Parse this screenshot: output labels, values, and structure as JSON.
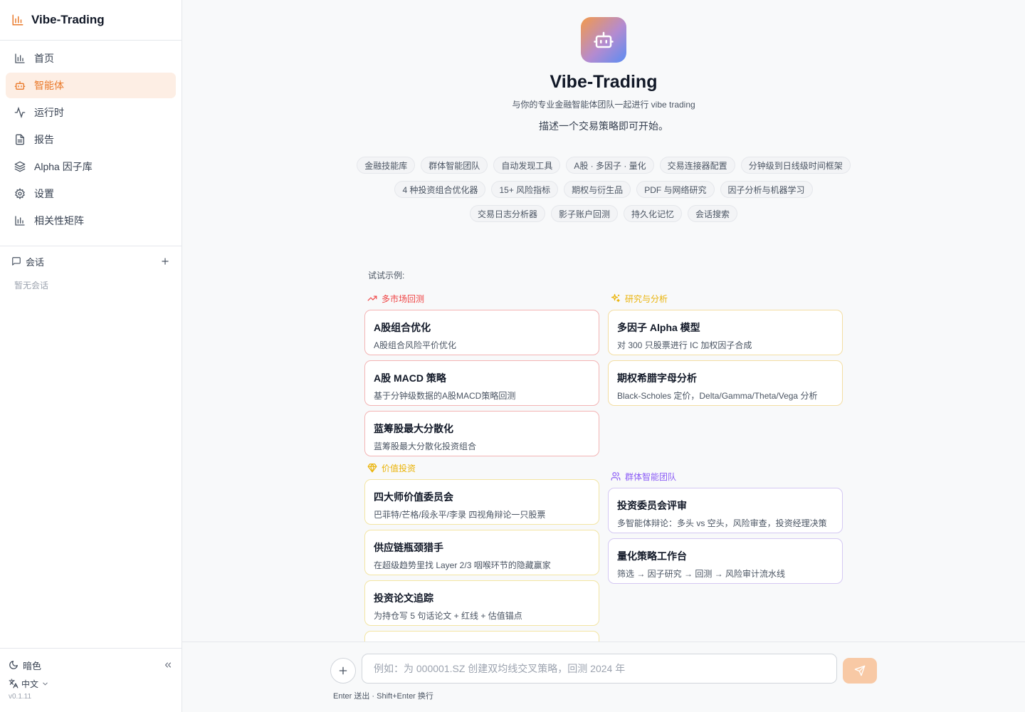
{
  "sidebar": {
    "brand": "Vibe-Trading",
    "nav": [
      {
        "label": "首页",
        "icon": "bar-chart-icon"
      },
      {
        "label": "智能体",
        "icon": "bot-icon",
        "active": true
      },
      {
        "label": "运行时",
        "icon": "activity-icon"
      },
      {
        "label": "报告",
        "icon": "file-icon"
      },
      {
        "label": "Alpha 因子库",
        "icon": "layers-icon"
      },
      {
        "label": "设置",
        "icon": "gear-icon"
      },
      {
        "label": "相关性矩阵",
        "icon": "bar-chart-icon"
      }
    ],
    "sessions_title": "会话",
    "sessions_empty": "暂无会话",
    "theme_label": "暗色",
    "language": "中文",
    "version": "v0.1.11"
  },
  "hero": {
    "title": "Vibe-Trading",
    "subtitle": "与你的专业金融智能体团队一起进行 vibe trading",
    "description": "描述一个交易策略即可开始。"
  },
  "tags": [
    "金融技能库",
    "群体智能团队",
    "自动发现工具",
    "A股 · 多因子 · 量化",
    "交易连接器配置",
    "分钟级到日线级时间框架",
    "4 种投资组合优化器",
    "15+ 风险指标",
    "期权与衍生品",
    "PDF 与网络研究",
    "因子分析与机器学习",
    "交易日志分析器",
    "影子账户回测",
    "持久化记忆",
    "会话搜索"
  ],
  "examples": {
    "label": "试试示例:",
    "categories": [
      {
        "name": "多市场回测",
        "color": "#ef4444",
        "border": "#f3b4b4",
        "icon": "trending-up-icon",
        "cards": [
          {
            "title": "A股组合优化",
            "desc": "A股组合风险平价优化"
          },
          {
            "title": "A股 MACD 策略",
            "desc": "基于分钟级数据的A股MACD策略回测"
          },
          {
            "title": "蓝筹股最大分散化",
            "desc": "蓝筹股最大分散化投资组合"
          }
        ]
      },
      {
        "name": "研究与分析",
        "color": "#eab308",
        "border": "#f3dea3",
        "icon": "sparkles-icon",
        "cards": [
          {
            "title": "多因子 Alpha 模型",
            "desc": "对 300 只股票进行 IC 加权因子合成"
          },
          {
            "title": "期权希腊字母分析",
            "desc": "Black-Scholes 定价，Delta/Gamma/Theta/Vega 分析"
          }
        ]
      },
      {
        "name": "价值投资",
        "color": "#eab308",
        "border": "#f3e5a3",
        "icon": "gem-icon",
        "cards": [
          {
            "title": "四大师价值委员会",
            "desc": "巴菲特/芒格/段永平/李录 四视角辩论一只股票"
          },
          {
            "title": "供应链瓶颈猎手",
            "desc": "在超级趋势里找 Layer 2/3 咽喉环节的隐藏赢家"
          },
          {
            "title": "投资论文追踪",
            "desc": "为持仓写 5 句话论文 + 红线 + 估值锚点"
          },
          {
            "title": "",
            "desc": ""
          }
        ]
      },
      {
        "name": "群体智能团队",
        "color": "#8b5cf6",
        "border": "#d4c8f2",
        "icon": "users-icon",
        "cards": [
          {
            "title": "投资委员会评审",
            "desc": "多智能体辩论：多头 vs 空头，风险审查，投资经理决策"
          },
          {
            "title": "量化策略工作台",
            "desc": "筛选 → 因子研究 → 回测 → 风险审计流水线"
          }
        ]
      }
    ]
  },
  "composer": {
    "placeholder": "例如：为 000001.SZ 创建双均线交叉策略，回测 2024 年",
    "hint": "Enter 送出 · Shift+Enter 换行"
  }
}
